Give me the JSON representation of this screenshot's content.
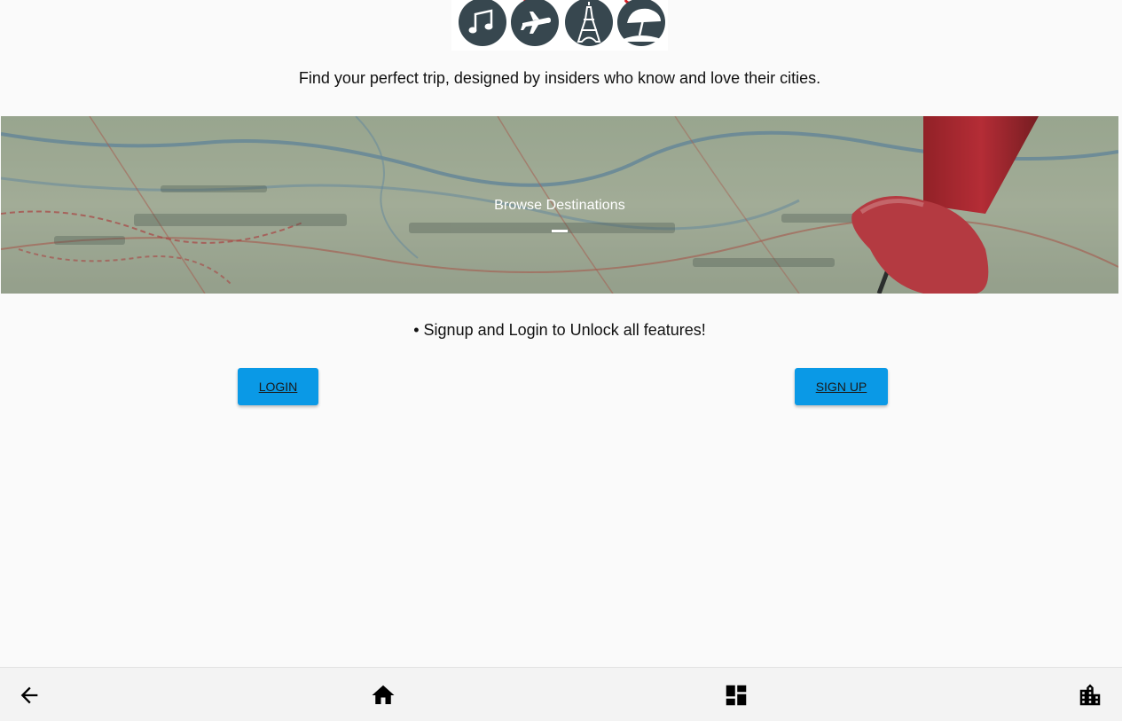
{
  "header": {
    "tagline": "Find your perfect trip, designed by insiders who know and love their cities.",
    "logo_icons": [
      "music-note-icon",
      "airplane-icon",
      "eiffel-tower-icon",
      "beach-umbrella-icon"
    ]
  },
  "banner": {
    "title": "Browse Destinations"
  },
  "auth": {
    "notice": "• Signup and Login to Unlock all features!",
    "login_label": "LOGIN",
    "signup_label": "SIGN UP"
  },
  "bottom_nav": {
    "items": [
      "arrow-back-icon",
      "home-icon",
      "dashboard-icon",
      "city-icon"
    ]
  },
  "colors": {
    "background": "#fafafa",
    "button": "#0a99e6",
    "logo_circle": "#37474f",
    "nav_bar": "#f3f3f3"
  }
}
